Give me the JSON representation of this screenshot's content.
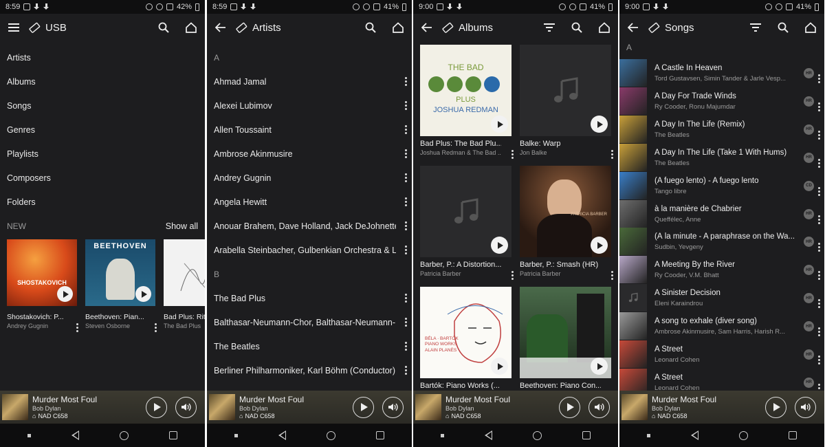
{
  "colors": {
    "background": "#1d1d1f",
    "status_bar": "#0f0f10",
    "text": "#eaeaea",
    "secondary_text": "#9c9c9c",
    "mini_player": "#34322b"
  },
  "screens": [
    {
      "status": {
        "time": "8:59",
        "battery": "42%"
      },
      "title": "USB",
      "nav_icon": "menu-icon",
      "menu": [
        "Artists",
        "Albums",
        "Songs",
        "Genres",
        "Playlists",
        "Composers",
        "Folders"
      ],
      "new_label": "NEW",
      "show_all": "Show all",
      "new_items": [
        {
          "title": "Shostakovich: P...",
          "subtitle": "Andrey Gugnin",
          "art_text": "SHOSTAKOVICH"
        },
        {
          "title": "Beethoven: Pian...",
          "subtitle": "Steven Osborne",
          "art_text": "BEETHOVEN"
        },
        {
          "title": "Bad Plus: Rit",
          "subtitle": "The Bad Plus",
          "art_text": ""
        }
      ]
    },
    {
      "status": {
        "time": "8:59",
        "battery": "41%"
      },
      "title": "Artists",
      "nav_icon": "back-arrow-icon",
      "rows": [
        {
          "type": "letter",
          "text": "A"
        },
        {
          "type": "item",
          "text": "Ahmad Jamal"
        },
        {
          "type": "item",
          "text": "Alexei Lubimov"
        },
        {
          "type": "item",
          "text": "Allen Toussaint"
        },
        {
          "type": "item",
          "text": "Ambrose Akinmusire"
        },
        {
          "type": "item",
          "text": "Andrey Gugnin"
        },
        {
          "type": "item",
          "text": "Angela Hewitt"
        },
        {
          "type": "item",
          "text": "Anouar Brahem, Dave Holland, Jack DeJohnette ..."
        },
        {
          "type": "item",
          "text": "Arabella Steinbacher, Gulbenkian Orchestra & La..."
        },
        {
          "type": "letter",
          "text": "B"
        },
        {
          "type": "item",
          "text": "The Bad Plus"
        },
        {
          "type": "item",
          "text": "Balthasar-Neumann-Chor, Balthasar-Neumann-E..."
        },
        {
          "type": "item",
          "text": "The Beatles"
        },
        {
          "type": "item",
          "text": "Berliner Philharmoniker, Karl Böhm (Conductor)"
        }
      ]
    },
    {
      "status": {
        "time": "9:00",
        "battery": "41%"
      },
      "title": "Albums",
      "nav_icon": "back-arrow-icon",
      "albums": [
        {
          "title": "Bad Plus: The Bad Plu...",
          "subtitle": "Joshua Redman & The Bad ...",
          "art": "badplus",
          "art_line1": "THE BAD",
          "art_line2": "PLUS",
          "art_line3": "JOSHUA REDMAN"
        },
        {
          "title": "Balke: Warp",
          "subtitle": "Jon Balke",
          "art": "placeholder"
        },
        {
          "title": "Barber, P.: A Distortion...",
          "subtitle": "Patricia Barber",
          "art": "placeholder"
        },
        {
          "title": "Barber, P.: Smash (HR)",
          "subtitle": "Patricia Barber",
          "art": "barber",
          "art_text": "PATRICIA BARBER"
        },
        {
          "title": "Bartók: Piano Works (...",
          "subtitle": "",
          "art": "bartok",
          "art_text": "BÉLA · BARTÓK PIANO WORKS ALAIN PLANÈS"
        },
        {
          "title": "Beethoven: Piano Con...",
          "subtitle": "",
          "art": "beethoven"
        }
      ]
    },
    {
      "status": {
        "time": "9:00",
        "battery": "41%"
      },
      "title": "Songs",
      "nav_icon": "back-arrow-icon",
      "letter": "A",
      "songs": [
        {
          "title": "A Castle In Heaven",
          "subtitle": "Tord Gustavsen, Simin Tander & Jarle Vesp...",
          "badge": "HR",
          "thumb": "#3b6f9e"
        },
        {
          "title": "A Day For Trade Winds",
          "subtitle": "Ry Cooder, Ronu Majumdar",
          "badge": "HR",
          "thumb": "#8a3b6a"
        },
        {
          "title": "A Day In The Life (Remix)",
          "subtitle": "The Beatles",
          "badge": "HR",
          "thumb": "#c9a03a"
        },
        {
          "title": "A Day In The Life (Take 1 With Hums)",
          "subtitle": "The Beatles",
          "badge": "HR",
          "thumb": "#c9a03a"
        },
        {
          "title": "(A fuego lento) - A fuego lento",
          "subtitle": "Tango libre",
          "badge": "CD",
          "thumb": "#3a7fc9"
        },
        {
          "title": "à la manière de Chabrier",
          "subtitle": "Queffélec, Anne",
          "badge": "HR",
          "thumb": "#6e6e6e"
        },
        {
          "title": "(À la minute - A paraphrase on the Wa...",
          "subtitle": "Sudbin, Yevgeny",
          "badge": "HR",
          "thumb": "#4a6a3a"
        },
        {
          "title": "A Meeting By the River",
          "subtitle": "Ry Cooder, V.M. Bhatt",
          "badge": "HR",
          "thumb": "#b8a8c8"
        },
        {
          "title": "A Sinister Decision",
          "subtitle": "Eleni Karaindrou",
          "badge": "HR",
          "thumb": "placeholder"
        },
        {
          "title": "A song to exhale (diver song)",
          "subtitle": "Ambrose Akinmusire, Sam Harris, Harish R...",
          "badge": "HR",
          "thumb": "#9a9a9a"
        },
        {
          "title": "A Street",
          "subtitle": "Leonard Cohen",
          "badge": "HR",
          "thumb": "#c84a3a"
        },
        {
          "title": "A Street",
          "subtitle": "Leonard Cohen",
          "badge": "HR",
          "thumb": "#c84a3a"
        }
      ]
    }
  ],
  "now_playing": {
    "title": "Murder Most Foul",
    "artist": "Bob Dylan",
    "device": "NAD C658"
  }
}
